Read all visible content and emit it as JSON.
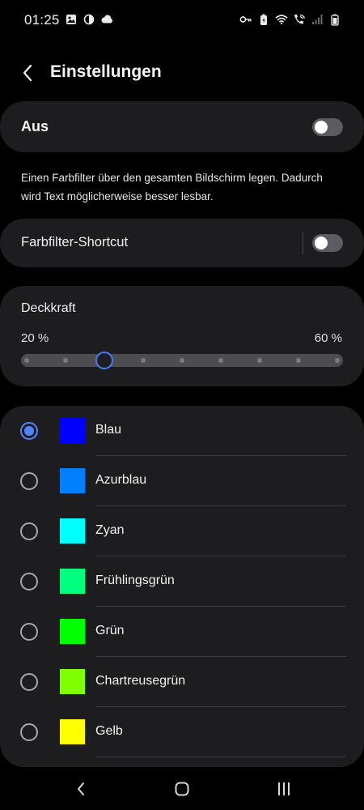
{
  "status_bar": {
    "time": "01:25"
  },
  "header": {
    "title": "Einstellungen"
  },
  "main_toggle": {
    "label": "Aus",
    "on": false
  },
  "description": "Einen Farbfilter über den gesamten Bildschirm legen. Dadurch wird Text möglicherweise besser lesbar.",
  "shortcut": {
    "label": "Farbfilter-Shortcut",
    "on": false
  },
  "opacity": {
    "title": "Deckkraft",
    "min_label": "20 %",
    "max_label": "60 %",
    "steps": 9,
    "selected_step": 2
  },
  "colors": [
    {
      "name": "Blau",
      "hex": "#0000ff",
      "selected": true
    },
    {
      "name": "Azurblau",
      "hex": "#007fff",
      "selected": false
    },
    {
      "name": "Zyan",
      "hex": "#00ffff",
      "selected": false
    },
    {
      "name": "Frühlingsgrün",
      "hex": "#00ff7f",
      "selected": false
    },
    {
      "name": "Grün",
      "hex": "#00ff00",
      "selected": false
    },
    {
      "name": "Chartreusegrün",
      "hex": "#7fff00",
      "selected": false
    },
    {
      "name": "Gelb",
      "hex": "#ffff00",
      "selected": false
    }
  ],
  "theme": {
    "accent": "#4f83ff",
    "card_bg": "#1d1d20",
    "background": "#000000"
  },
  "icons": {
    "status_left": [
      "gallery-icon",
      "half-circle-icon",
      "cloud-icon"
    ],
    "status_right": [
      "key-icon",
      "battery-saver-icon",
      "wifi-icon",
      "wifi-call-icon",
      "signal-icon",
      "battery-icon"
    ],
    "nav": [
      "back-nav-icon",
      "home-nav-icon",
      "recents-nav-icon"
    ]
  }
}
